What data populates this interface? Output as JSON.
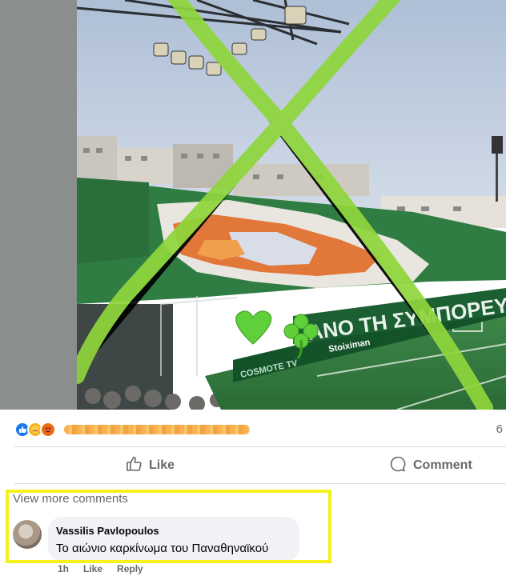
{
  "post": {
    "reaction_count": "6",
    "reactions": [
      "like-icon",
      "care-icon",
      "angry-icon"
    ]
  },
  "actions": {
    "like_label": "Like",
    "comment_label": "Comment"
  },
  "comments": {
    "view_more_label": "View more comments",
    "items": [
      {
        "author": "Vassilis Pavlopoulos",
        "text": "Το αιώνιο καρκίνωμα του Παναθηναϊκού",
        "time": "1h",
        "like_label": "Like",
        "reply_label": "Reply"
      }
    ]
  },
  "photo": {
    "banner_text": "ΑΝΟ   ΤΗ   ΣΥΜΠΟΡΕΥΟΥΣ",
    "sponsor_text": "COSMOTE TV",
    "sponsor2_text": "Stoiximan"
  },
  "colors": {
    "cross": "#8fd63c",
    "highlight": "#f4f11c",
    "like_blue": "#1877f2",
    "pitch": "#2e6e3a"
  }
}
